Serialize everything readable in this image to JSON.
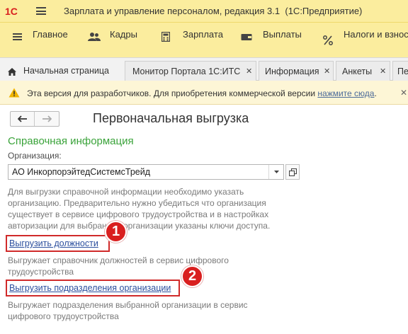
{
  "app": {
    "logo_text": "1С",
    "title": "Зарплата и управление персоналом, редакция 3.1",
    "platform": "(1С:Предприятие)"
  },
  "sections": [
    {
      "label": "Главное",
      "icon": "hamburger-icon"
    },
    {
      "label": "Кадры",
      "icon": "people-icon"
    },
    {
      "label": "Зарплата",
      "icon": "calculator-icon"
    },
    {
      "label": "Выплаты",
      "icon": "wallet-icon"
    },
    {
      "label": "Налоги и взносы",
      "icon": "percent-icon"
    }
  ],
  "tabs": [
    {
      "label": "Начальная страница",
      "icon": "home-icon"
    },
    {
      "label": "Монитор Портала 1С:ИТС"
    },
    {
      "label": "Информация"
    },
    {
      "label": "Анкеты"
    },
    {
      "label": "Пе"
    }
  ],
  "banner": {
    "text": "Эта версия для разработчиков. Для приобретения коммерческой версии",
    "link": "нажмите сюда",
    "link_suffix": ".",
    "close": "✕"
  },
  "form": {
    "title": "Первоначальная выгрузка",
    "group_title": "Справочная информация",
    "org_label": "Организация:",
    "org_value": "АО ИнкорпорэйтедСистемсТрейд",
    "hint_main": "Для выгрузки справочной информации необходимо указать организацию. Предварительно нужно убедиться что организация существует в сервисе цифрового трудоустройства и в настройках авторизации для выбранной организации указаны ключи доступа.",
    "link_positions": "Выгрузить должности",
    "hint_positions": "Выгружает справочник должностей в сервис цифрового трудоустройства",
    "link_departments": "Выгрузить подразделения организации",
    "hint_departments": "Выгружает подразделения выбранной организации в сервис цифрового трудоустройства"
  },
  "callouts": [
    "1",
    "2"
  ],
  "colors": {
    "header_bg": "#fbed9e",
    "group_title": "#3aa33a",
    "link": "#2c4f9e",
    "highlight": "#d02a2a",
    "warning": "#f0b400"
  }
}
